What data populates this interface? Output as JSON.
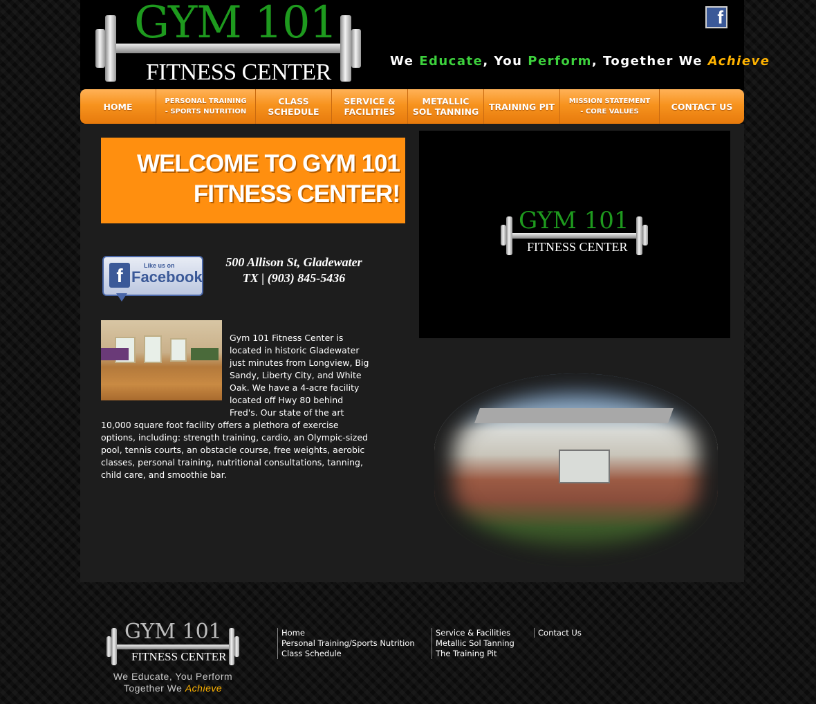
{
  "header": {
    "logo_title": "GYM 101",
    "logo_subtitle": "FITNESS CENTER",
    "tagline": {
      "p1": "We ",
      "educate": "Educate",
      "p2": ", You ",
      "perform": "Perform",
      "p3": ", Together We ",
      "achieve": "Achieve"
    },
    "facebook_icon": "facebook-icon"
  },
  "nav": {
    "items": [
      {
        "line1": "HOME",
        "line2": ""
      },
      {
        "line1": "PERSONAL TRAINING",
        "line2": "- SPORTS NUTRITION"
      },
      {
        "line1": "CLASS",
        "line2": "SCHEDULE"
      },
      {
        "line1": "SERVICE &",
        "line2": "FACILITIES"
      },
      {
        "line1": "METALLIC",
        "line2": "SOL TANNING"
      },
      {
        "line1": "TRAINING PIT",
        "line2": ""
      },
      {
        "line1": "MISSION STATEMENT",
        "line2": "- CORE VALUES"
      },
      {
        "line1": "CONTACT US",
        "line2": ""
      }
    ]
  },
  "main": {
    "welcome_line1": "WELCOME TO GYM 101",
    "welcome_line2": "FITNESS CENTER!",
    "video_logo_title": "GYM 101",
    "video_logo_subtitle": "FITNESS CENTER",
    "fb_like_small": "Like us on",
    "fb_like_big": "Facebook",
    "address_line1": "500 Allison St, Gladewater",
    "address_line2": "TX | (903) 845-5436",
    "description": "Gym 101 Fitness Center is located in historic Gladewater just minutes from Longview, Big Sandy, Liberty City, and White Oak. We have a 4-acre facility located off Hwy 80 behind Fred's. Our state of the art 10,000 square foot facility offers a plethora of exercise options, including: strength training, cardio, an Olympic-sized pool, tennis courts, an obstacle course, free weights, aerobic classes, personal training, nutritional consultations, tanning, child care, and smoothie bar."
  },
  "footer": {
    "logo_title": "GYM 101",
    "logo_subtitle": "FITNESS CENTER",
    "tag_line1": "We Educate, You Perform",
    "tag_line2_a": "Together We ",
    "tag_line2_b": "Achieve",
    "col1": [
      "Home",
      "Personal Training/Sports Nutrition",
      "Class Schedule"
    ],
    "col2": [
      "Service & Facilities",
      "Metallic Sol Tanning",
      "The Training Pit"
    ],
    "col3": [
      "Contact Us"
    ]
  },
  "colors": {
    "accent_orange": "#f7931e",
    "accent_green": "#1e9a1e",
    "achieve_yellow": "#ffb300",
    "facebook_blue": "#3b5998"
  }
}
